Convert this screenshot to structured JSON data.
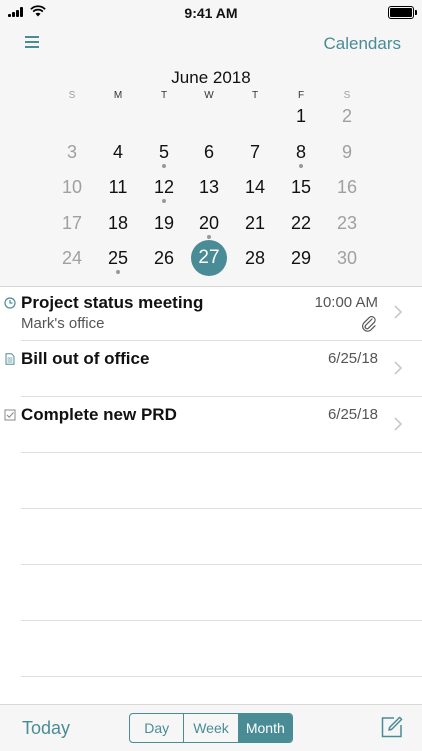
{
  "status_bar": {
    "time": "9:41 AM"
  },
  "header": {
    "calendars_label": "Calendars",
    "month_title": "June 2018"
  },
  "calendar": {
    "weekdays": [
      "S",
      "M",
      "T",
      "W",
      "T",
      "F",
      "S"
    ],
    "selected_day": "27",
    "weeks": [
      [
        null,
        null,
        null,
        null,
        null,
        "1",
        "2"
      ],
      [
        "3",
        "4",
        "5",
        "6",
        "7",
        "8",
        "9"
      ],
      [
        "10",
        "11",
        "12",
        "13",
        "14",
        "15",
        "16"
      ],
      [
        "17",
        "18",
        "19",
        "20",
        "21",
        "22",
        "23"
      ],
      [
        "24",
        "25",
        "26",
        "27",
        "28",
        "29",
        "30"
      ]
    ],
    "days_with_events": [
      "5",
      "8",
      "12",
      "20",
      "25"
    ]
  },
  "events": [
    {
      "title": "Project status meeting",
      "subtitle": "Mark's office",
      "time": "10:00 AM",
      "icon": "clock-icon",
      "attachment": true
    },
    {
      "title": "Bill out of office",
      "subtitle": "",
      "time": "6/25/18",
      "icon": "document-icon",
      "attachment": false
    },
    {
      "title": "Complete new PRD",
      "subtitle": "",
      "time": "6/25/18",
      "icon": "checkbox-icon",
      "attachment": false
    }
  ],
  "toolbar": {
    "today_label": "Today",
    "views": [
      "Day",
      "Week",
      "Month"
    ],
    "active_view": "Month"
  },
  "colors": {
    "accent": "#4a8c96",
    "header_bg": "#f6f6f6",
    "muted_day": "#a0a0a0",
    "event_dot": "#999999"
  }
}
